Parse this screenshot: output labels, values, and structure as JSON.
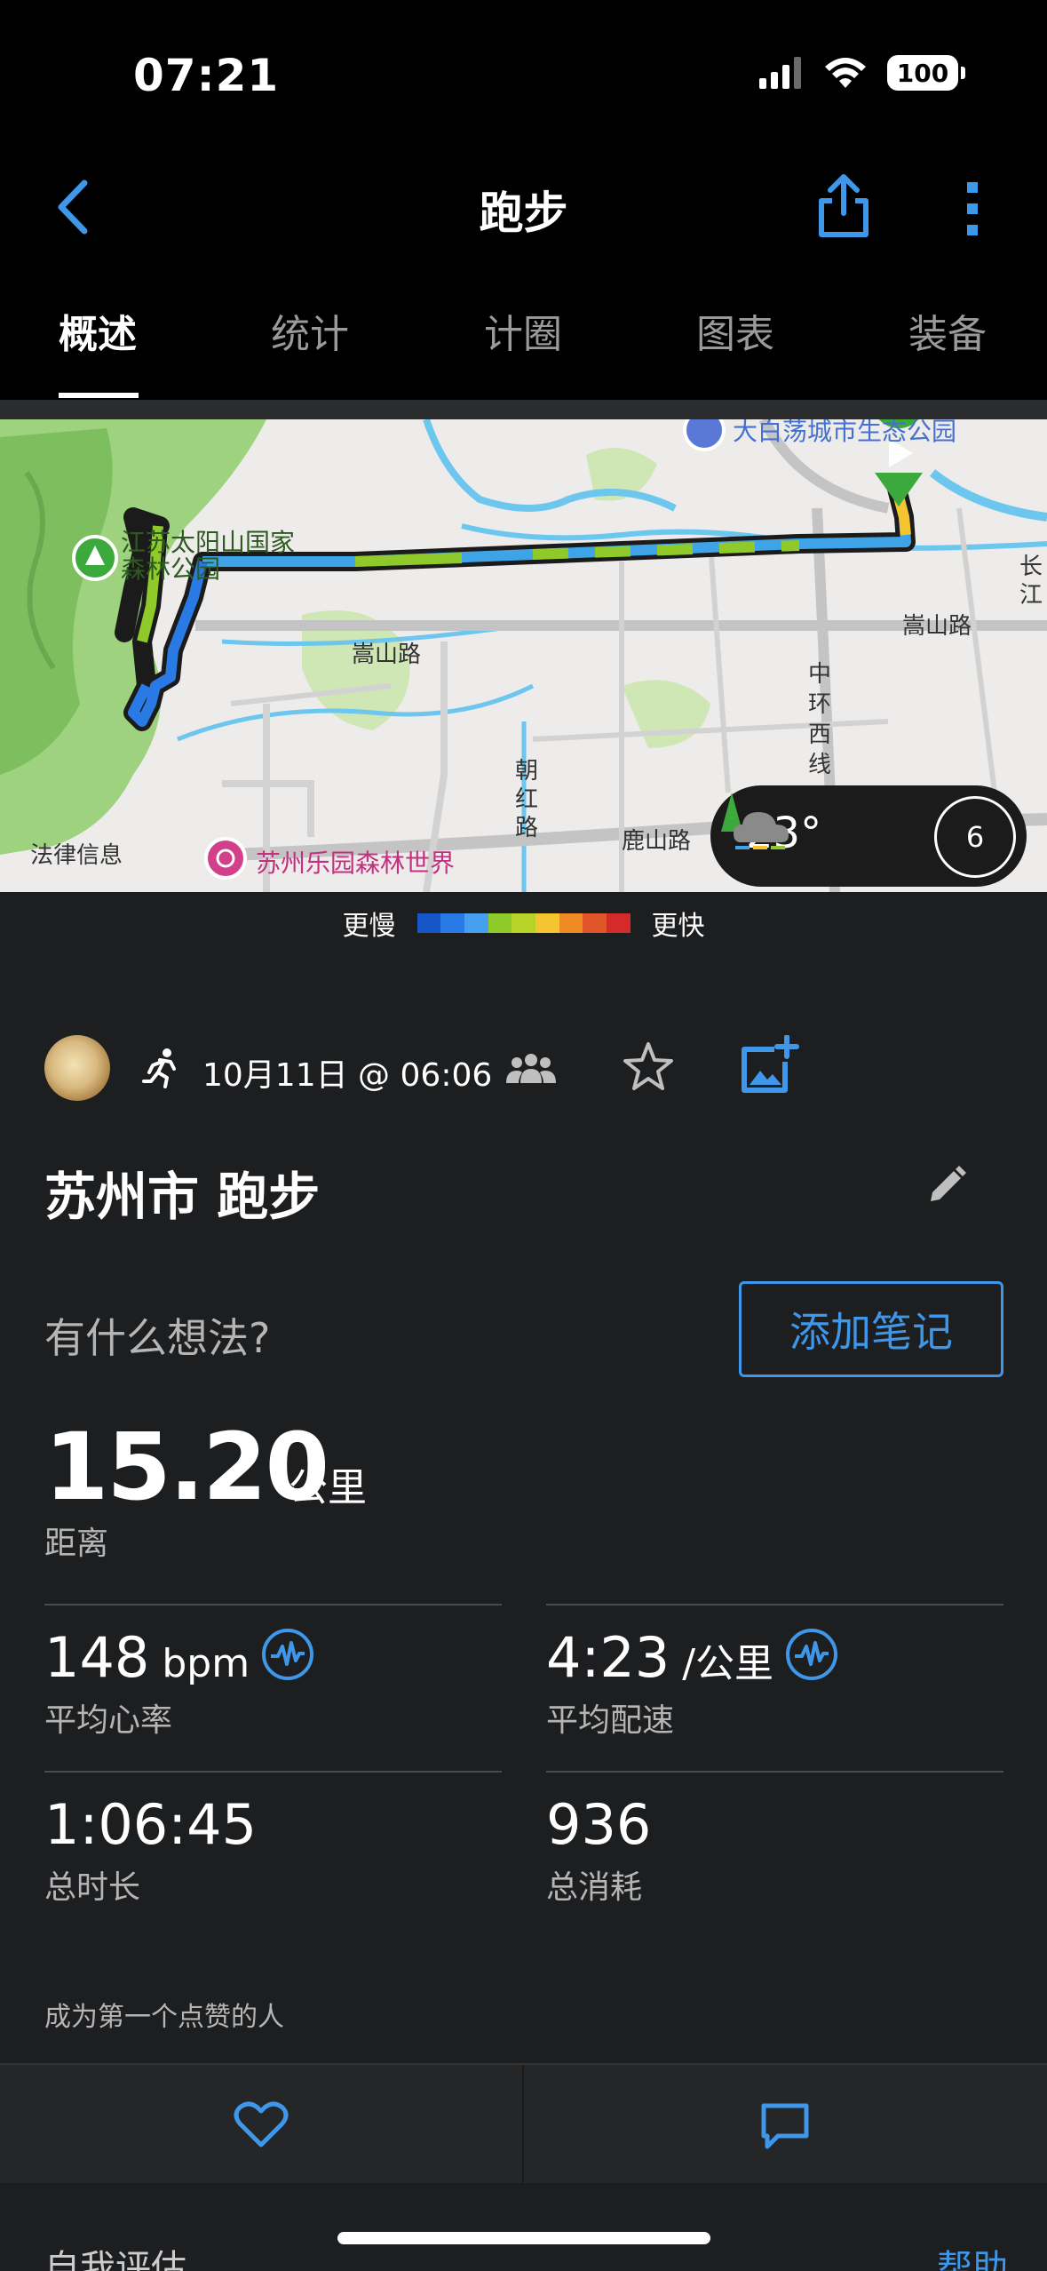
{
  "status_bar": {
    "time": "07:21",
    "battery": "100"
  },
  "nav": {
    "title": "跑步"
  },
  "tabs": [
    {
      "label": "概述",
      "active": true
    },
    {
      "label": "统计",
      "active": false
    },
    {
      "label": "计圈",
      "active": false
    },
    {
      "label": "图表",
      "active": false
    },
    {
      "label": "装备",
      "active": false
    }
  ],
  "map": {
    "labels": {
      "park_north": "大白荡城市生态公园",
      "forest_park": "江苏太阳山国家森林公园",
      "road_songshan_left": "嵩山路",
      "road_songshan_right": "嵩山路",
      "road_zhonghuan": "中环西线",
      "road_chaohong": "朝红路",
      "road_lushan": "鹿山路",
      "amusement": "苏州乐园森林世界",
      "legal": "法律信息",
      "changjiang": "长江"
    },
    "weather": {
      "temperature": "23°",
      "moon_phase": "6"
    }
  },
  "legend": {
    "slower": "更慢",
    "faster": "更快",
    "colors": [
      "#1656c6",
      "#2a7ae6",
      "#45a0f0",
      "#8fca2a",
      "#b7d32a",
      "#f5c531",
      "#f08a24",
      "#e0562a",
      "#d52a2a"
    ]
  },
  "activity": {
    "date": "10月11日 @ 06:06",
    "title": "苏州市 跑步",
    "note_prompt": "有什么想法?",
    "note_button": "添加笔记",
    "distance": {
      "value": "15.20",
      "unit": "公里",
      "label": "距离"
    },
    "stats": [
      {
        "value": "148",
        "unit": " bpm",
        "label": "平均心率",
        "pulse": true
      },
      {
        "value": "4:23",
        "unit": " /公里",
        "label": "平均配速",
        "pulse": true
      },
      {
        "value": "1:06:45",
        "unit": "",
        "label": "总时长",
        "pulse": false
      },
      {
        "value": "936",
        "unit": "",
        "label": "总消耗",
        "pulse": false
      }
    ],
    "like_prompt": "成为第一个点赞的人"
  },
  "footer": {
    "self_eval": "自我评估",
    "help": "帮助"
  },
  "accent_color": "#3f97ea"
}
